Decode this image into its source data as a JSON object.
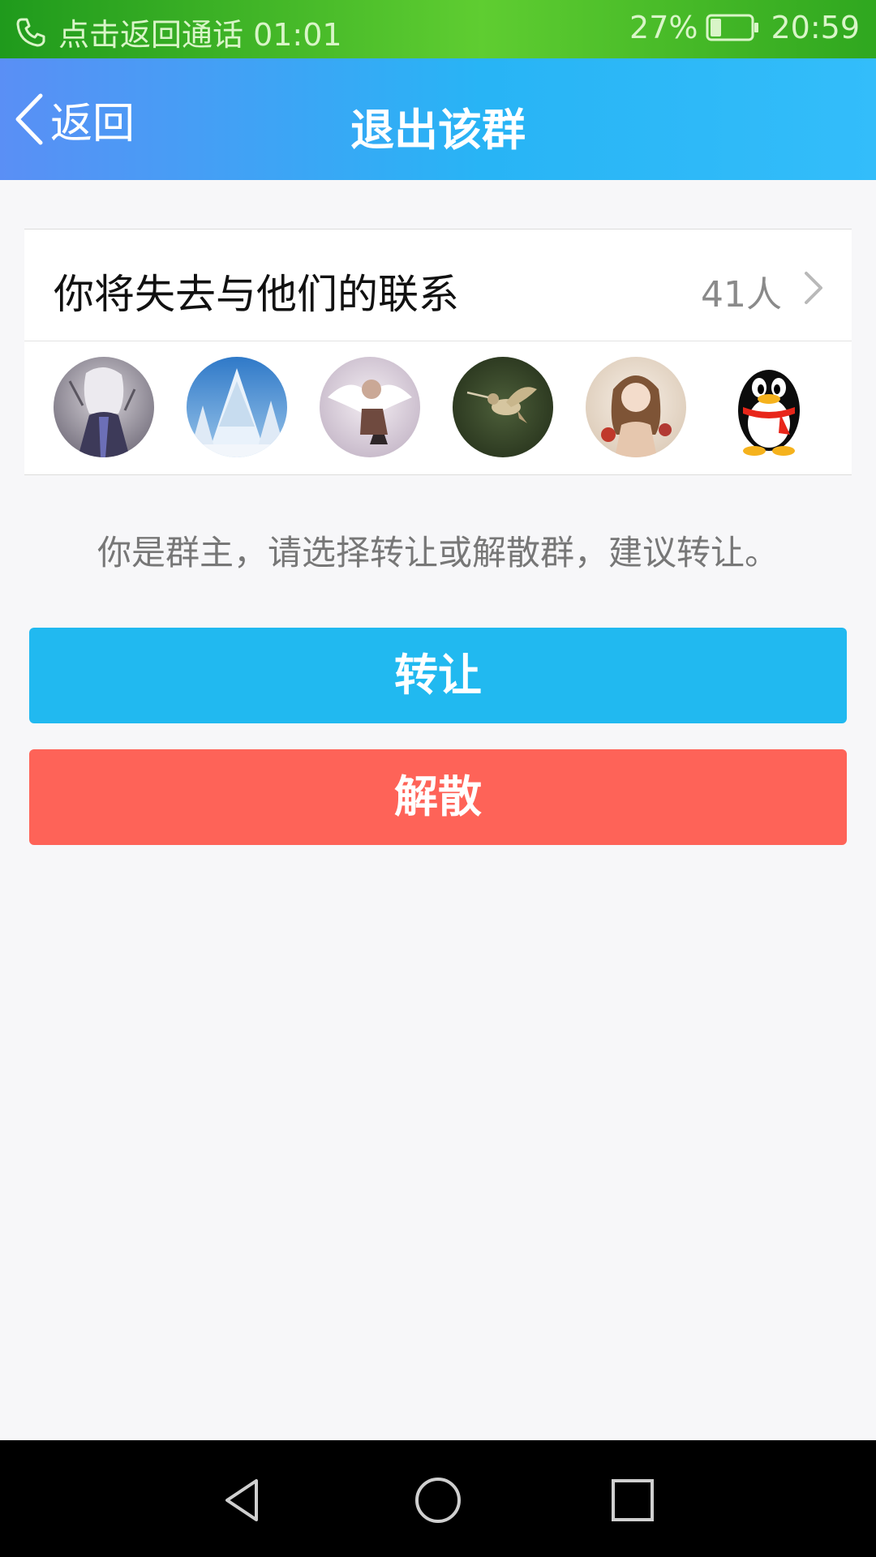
{
  "status_bar": {
    "call_text": "点击返回通话 01:01",
    "battery_percent": "27%",
    "battery_level": 0.27,
    "time": "20:59",
    "icons": [
      "phone-icon",
      "battery-icon"
    ]
  },
  "header": {
    "back_label": "返回",
    "title": "退出该群"
  },
  "members_card": {
    "title": "你将失去与他们的联系",
    "count_label": "41人",
    "avatars": [
      "avatar-anime-girl-dark",
      "avatar-snowy-trees",
      "avatar-angel-wings",
      "avatar-hummingbird",
      "avatar-anime-girl-flowers",
      "avatar-qq-penguin"
    ]
  },
  "hint": "你是群主，请选择转让或解散群，建议转让。",
  "buttons": {
    "transfer": "转让",
    "dissolve": "解散"
  },
  "colors": {
    "status_bar": "#3fb826",
    "title_bar": "#28b4f5",
    "transfer_button": "#21b9f0",
    "dissolve_button": "#fe6358"
  }
}
